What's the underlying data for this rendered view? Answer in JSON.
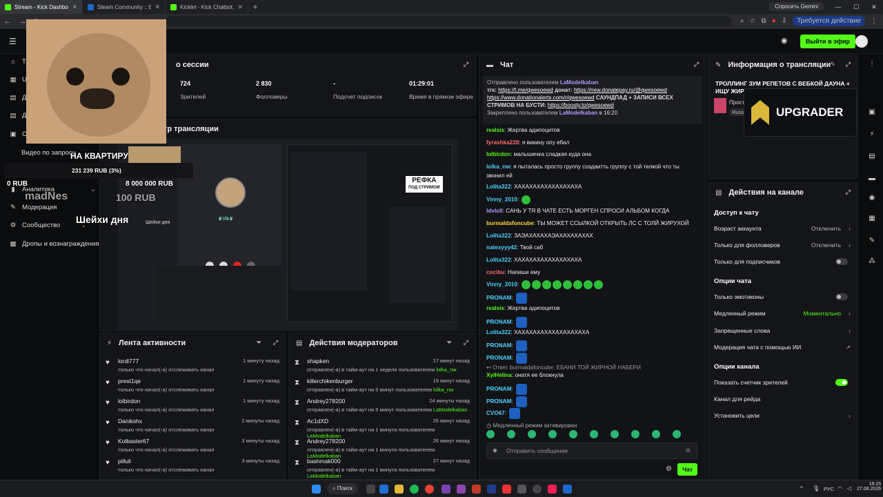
{
  "browser": {
    "tabs": [
      {
        "label": "Stream - Kick Dashboard",
        "color": "#53fc18"
      },
      {
        "label": "Steam Community :: Edriset",
        "color": "#1b6ac9"
      },
      {
        "label": "Kicklet - Kick Chatbot, Kick Wi",
        "color": "#53fc18"
      }
    ],
    "gemini": "Спросить Gemini",
    "update_badge": "Требуется действие"
  },
  "header": {
    "go_live": "Выйти в эфир"
  },
  "sidebar": {
    "items": [
      {
        "label": "Тр",
        "icon": "home-icon"
      },
      {
        "label": "UI",
        "icon": "layout-icon"
      },
      {
        "label": "Д",
        "icon": "doc-icon"
      },
      {
        "label": "Д",
        "icon": "doc-icon"
      },
      {
        "label": "С",
        "icon": "settings-icon"
      },
      {
        "label": "Видео по запросу",
        "icon": ""
      },
      {
        "label": "Аналитика",
        "icon": "chart-icon"
      },
      {
        "label": "Модерация",
        "icon": "wrench-icon"
      },
      {
        "label": "Сообщество",
        "icon": "gear-icon"
      },
      {
        "label": "Дропы и вознаграждения",
        "icon": "gift-icon"
      }
    ]
  },
  "session": {
    "title": "о сессии",
    "stats": [
      {
        "value": "724",
        "label": "Зрителей"
      },
      {
        "value": "2 830",
        "label": "Фолловеры"
      },
      {
        "value": "-",
        "label": "Подсчет подписок"
      },
      {
        "value": "01:29:01",
        "label": "Время в прямом эфире"
      }
    ]
  },
  "preview": {
    "title": "тр трансляции",
    "refka": "РЕФКА",
    "refka_sub": "ПОД СТРИМОМ",
    "caller": "♛Vik♛"
  },
  "overlay": {
    "apartment": "НА КВАРТИРУ",
    "amount": "231 239 RUB (3%)",
    "zero": "0 RUB",
    "goal": "8 000 000 RUB",
    "donor": "madNes",
    "donor_amount": "100 RUB",
    "shake": "Шейхи дня",
    "shake_small": "Шейхи дня"
  },
  "activity": {
    "title": "Лента активности",
    "rows": [
      {
        "name": "lordi777",
        "text": "только что начал(-а) отслеживать канал",
        "time": "1 минуту назад"
      },
      {
        "name": "prest1qe",
        "text": "только что начал(-а) отслеживать канал",
        "time": "1 минуту назад"
      },
      {
        "name": "lolbirdon",
        "text": "только что начал(-а) отслеживать канал",
        "time": "1 минуту назад"
      },
      {
        "name": "Danikshx",
        "text": "только что начал(-а) отслеживать канал",
        "time": "2 минуты назад"
      },
      {
        "name": "Kolbaster67",
        "text": "только что начал(-а) отслеживать канал",
        "time": "3 минуты назад"
      },
      {
        "name": "pilluli",
        "text": "только что начал(-а) отслеживать канал",
        "time": "3 минуты назад"
      }
    ]
  },
  "mods": {
    "title": "Действия модераторов",
    "rows": [
      {
        "name": "shapken",
        "text": "отправлен(-а) в тайм-аут на 1 неделя пользователем",
        "by": "lolka_nw",
        "time": "17 минут назад"
      },
      {
        "name": "killerchikenburger",
        "text": "отправлен(-а) в тайм-аут на 5 минут пользователем",
        "by": "lolka_nw",
        "time": "19 минут назад"
      },
      {
        "name": "Andrey278200",
        "text": "отправлен(-а) в тайм-аут на 5 минут пользователем",
        "by": "LaModelkaban",
        "time": "24 минуты назад"
      },
      {
        "name": "Ac1dXD",
        "text": "отправлен(-а) в тайм-аут на 1 минута пользователем",
        "by": "LaModelkaban",
        "time": "26 минут назад"
      },
      {
        "name": "Andrey278200",
        "text": "отправлен(-а) в тайм-аут на 1 минута пользователем",
        "by": "LaModelkaban",
        "time": "26 минут назад"
      },
      {
        "name": "bashmak000",
        "text": "отправлен(-а) в тайм-аут на 1 минута пользователем",
        "by": "LaModelkaban",
        "time": "27 минут назад"
      }
    ]
  },
  "chat": {
    "title": "Чат",
    "pinned_by_label": "Отправлено пользователем",
    "pinned_by": "LaModelkaban",
    "pinned_l1a": "тгк:",
    "pinned_l1b": "https://t.me/qwesoewd",
    "pinned_l1c": "донат:",
    "pinned_l1d": "https://new.donatepay.ru/@qwesoewd",
    "pinned_l2": "https://www.donationalerts.com/r/qwesoewd",
    "pinned_l2b": "САУНДПАД + ЗАПИСИ ВСЕХ",
    "pinned_l3": "СТРИМОВ НА БУСТИ:",
    "pinned_l3b": "https://boosty.to/qwesoewd",
    "pinned_footer": "Закреплено пользователем",
    "pinned_footer_user": "LaModelkaban",
    "pinned_footer_time": "в 16:20",
    "messages": [
      {
        "user": "realsis",
        "cls": "u3",
        "text": "Жертва адипоцитов"
      },
      {
        "user": "fyrashka228",
        "cls": "u2",
        "text": "я викину опу ебал"
      },
      {
        "user": "lolbirdon",
        "cls": "u3",
        "text": "малышечка сладкая куда она"
      },
      {
        "user": "lolka_nw",
        "cls": "u1",
        "text": "я пыталась просто группу создаитть группу с той телкой что ты"
      },
      {
        "user": "",
        "cls": "",
        "text": "звонил ей"
      },
      {
        "user": "Lolita322",
        "cls": "u1",
        "text": "ХАХАХАХАХАХАХАХАХА"
      },
      {
        "user": "Vinny_2010",
        "cls": "u1",
        "text": ""
      },
      {
        "user": "ldvloll",
        "cls": "u5",
        "text": "САНЬ У ТЯ В ЧАТЕ ЕСТЬ МОРГЕН СПРОСИ АЛЬБОМ КОГДА"
      },
      {
        "user": "burmaldafoncube",
        "cls": "u4",
        "text": "ТЫ МОЖЕТ ССЫЛКОЙ ОТКРЫТЬ ЛС С ТОЛЙ ЖИРУХОЙ"
      },
      {
        "user": "Lolita322",
        "cls": "u1",
        "text": "ЗАЭАХАХАХАЭАХАХАХАХАХ"
      },
      {
        "user": "natexyyy42",
        "cls": "u1",
        "text": "Твой саб"
      },
      {
        "user": "Lolita322",
        "cls": "u1",
        "text": "ХАХАХАХАХАХАХАХАХА"
      },
      {
        "user": "cocibu",
        "cls": "u2",
        "text": "Напиши ему"
      },
      {
        "user": "Vinny_2010",
        "cls": "u1",
        "text": ""
      },
      {
        "user": "PRONAM",
        "cls": "u1",
        "text": ""
      },
      {
        "user": "realsis",
        "cls": "u3",
        "text": "Жертва адипоцитов"
      },
      {
        "user": "PRONAM",
        "cls": "u1",
        "text": ""
      },
      {
        "user": "Lolita322",
        "cls": "u1",
        "text": "ХАХАХАХАХАХАХАХАХАХА"
      },
      {
        "user": "PRONAM",
        "cls": "u1",
        "text": ""
      },
      {
        "user": "PRONAM",
        "cls": "u1",
        "text": ""
      },
      {
        "user": "",
        "cls": "",
        "text": "↩ Ответ burmaldafoncube: ЕБАНИ ТОЙ ЖИРНОЙ НАБЕРИ"
      },
      {
        "user": "XyiHelina",
        "cls": "u3",
        "text": "онатя ее блокнула"
      },
      {
        "user": "PRONAM",
        "cls": "u1",
        "text": ""
      },
      {
        "user": "PRONAM",
        "cls": "u1",
        "text": ""
      },
      {
        "user": "CVO67",
        "cls": "u1",
        "text": ""
      },
      {
        "user": "",
        "cls": "",
        "text": "Медленный режим активирован"
      }
    ],
    "input_placeholder": "Отправить сообщение",
    "send": "Чат"
  },
  "info": {
    "title": "Информация о трансляции",
    "stream_title": "ТРОЛЛИНГ ЗУМ РЕПЕТОВ С ВЕБКОЙ ДАУНА + ИЩУ ЖИРУХ",
    "cat1": "Прост",
    "cat2": "Russ",
    "upgrader": "UPGRADER"
  },
  "actions": {
    "title": "Действия на канале",
    "access": "Доступ к чату",
    "rows1": [
      {
        "label": "Возраст аккаунта",
        "value": "Отключить"
      },
      {
        "label": "Только для фолловеров",
        "value": "Отключить"
      }
    ],
    "subs_only": "Только для подписчиков",
    "chat_opts": "Опции чата",
    "emotes_only": "Только эмотиконы",
    "slow_mode": "Медленный режим",
    "slow_value": "Моментально",
    "banned_words": "Запрещенные слова",
    "ai_mod": "Модерация чата с помощью ИИ",
    "channel_opts": "Опции канала",
    "viewer_count": "Показать счетчик зрителей",
    "raid": "Канал для рейда",
    "goals": "Установить цели"
  },
  "taskbar": {
    "search": "Поиск",
    "lang": "РУС",
    "time": "18:15",
    "date": "27.08.2026"
  },
  "colors": {
    "accent": "#53fc18",
    "panel": "#141518",
    "bg": "#0b0c0e"
  }
}
